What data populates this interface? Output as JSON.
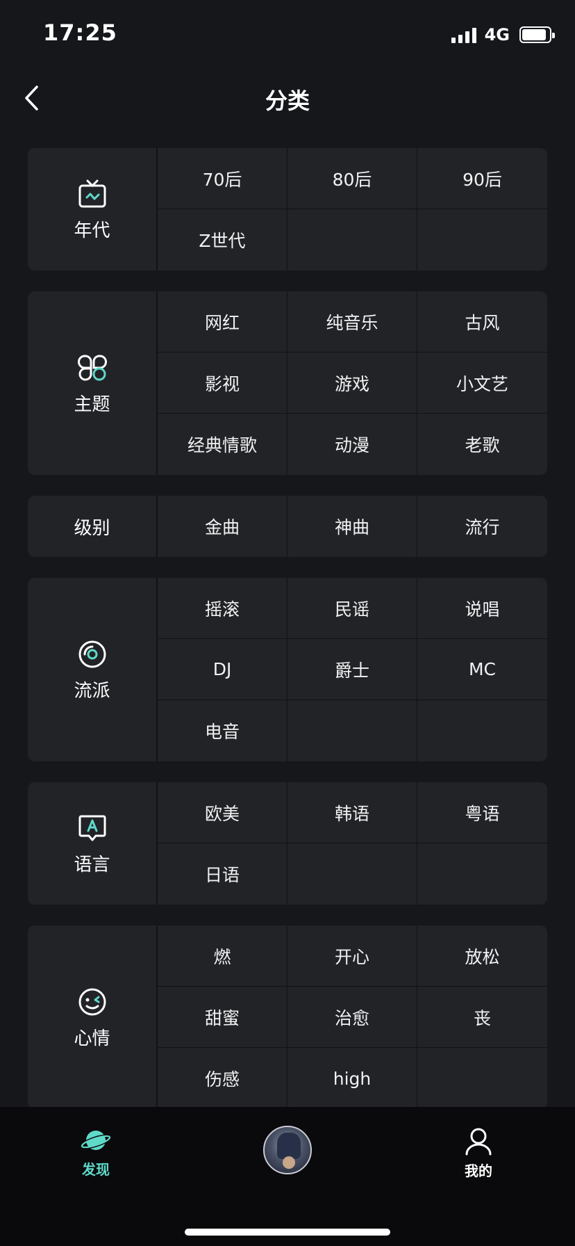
{
  "status_bar": {
    "time": "17:25",
    "network": "4G"
  },
  "nav": {
    "title": "分类"
  },
  "categories": [
    {
      "label": "年代",
      "icon": "tv-icon",
      "items": [
        "70后",
        "80后",
        "90后",
        "Z世代",
        "",
        ""
      ]
    },
    {
      "label": "主题",
      "icon": "theme-grid-icon",
      "items": [
        "网红",
        "纯音乐",
        "古风",
        "影视",
        "游戏",
        "小文艺",
        "经典情歌",
        "动漫",
        "老歌"
      ]
    },
    {
      "label": "级别",
      "icon": "",
      "items": [
        "金曲",
        "神曲",
        "流行"
      ]
    },
    {
      "label": "流派",
      "icon": "disc-icon",
      "items": [
        "摇滚",
        "民谣",
        "说唱",
        "DJ",
        "爵士",
        "MC",
        "电音",
        "",
        ""
      ]
    },
    {
      "label": "语言",
      "icon": "speech-a-icon",
      "items": [
        "欧美",
        "韩语",
        "粤语",
        "日语",
        "",
        ""
      ]
    },
    {
      "label": "心情",
      "icon": "wink-face-icon",
      "items": [
        "燃",
        "开心",
        "放松",
        "甜蜜",
        "治愈",
        "丧",
        "伤感",
        "high",
        ""
      ]
    }
  ],
  "tabbar": {
    "discover_label": "发现",
    "mine_label": "我的"
  },
  "colors": {
    "accent": "#5fd9c8",
    "background": "#16171b",
    "card": "#222327"
  }
}
